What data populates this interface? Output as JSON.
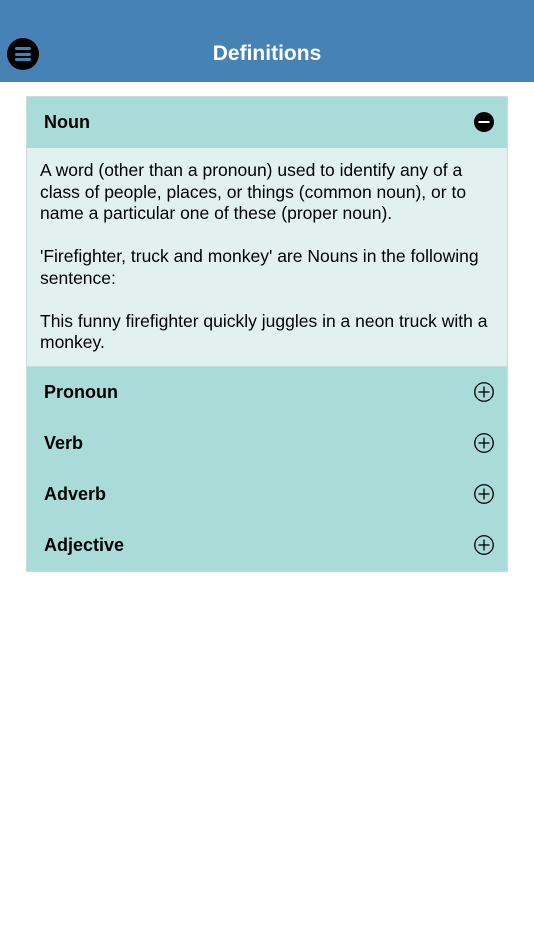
{
  "nav": {
    "title": "Definitions",
    "menu_icon": "hamburger-menu-icon"
  },
  "accordion": {
    "expanded": {
      "label": "Noun",
      "icon": "minus-circle-icon",
      "paragraphs": [
        "A word (other than a pronoun) used to identify any of a class of people, places, or things (common noun), or to name a particular one of these (proper noun).",
        "'Firefighter, truck and monkey' are Nouns in the following sentence:",
        "This funny firefighter quickly juggles in a neon truck with a monkey."
      ]
    },
    "collapsed": [
      {
        "label": "Pronoun",
        "icon": "plus-circle-icon"
      },
      {
        "label": "Verb",
        "icon": "plus-circle-icon"
      },
      {
        "label": "Adverb",
        "icon": "plus-circle-icon"
      },
      {
        "label": "Adjective",
        "icon": "plus-circle-icon"
      }
    ]
  },
  "colors": {
    "navbar": "#4682b4",
    "header": "#a9dbd8",
    "body": "#e2f1f0"
  }
}
